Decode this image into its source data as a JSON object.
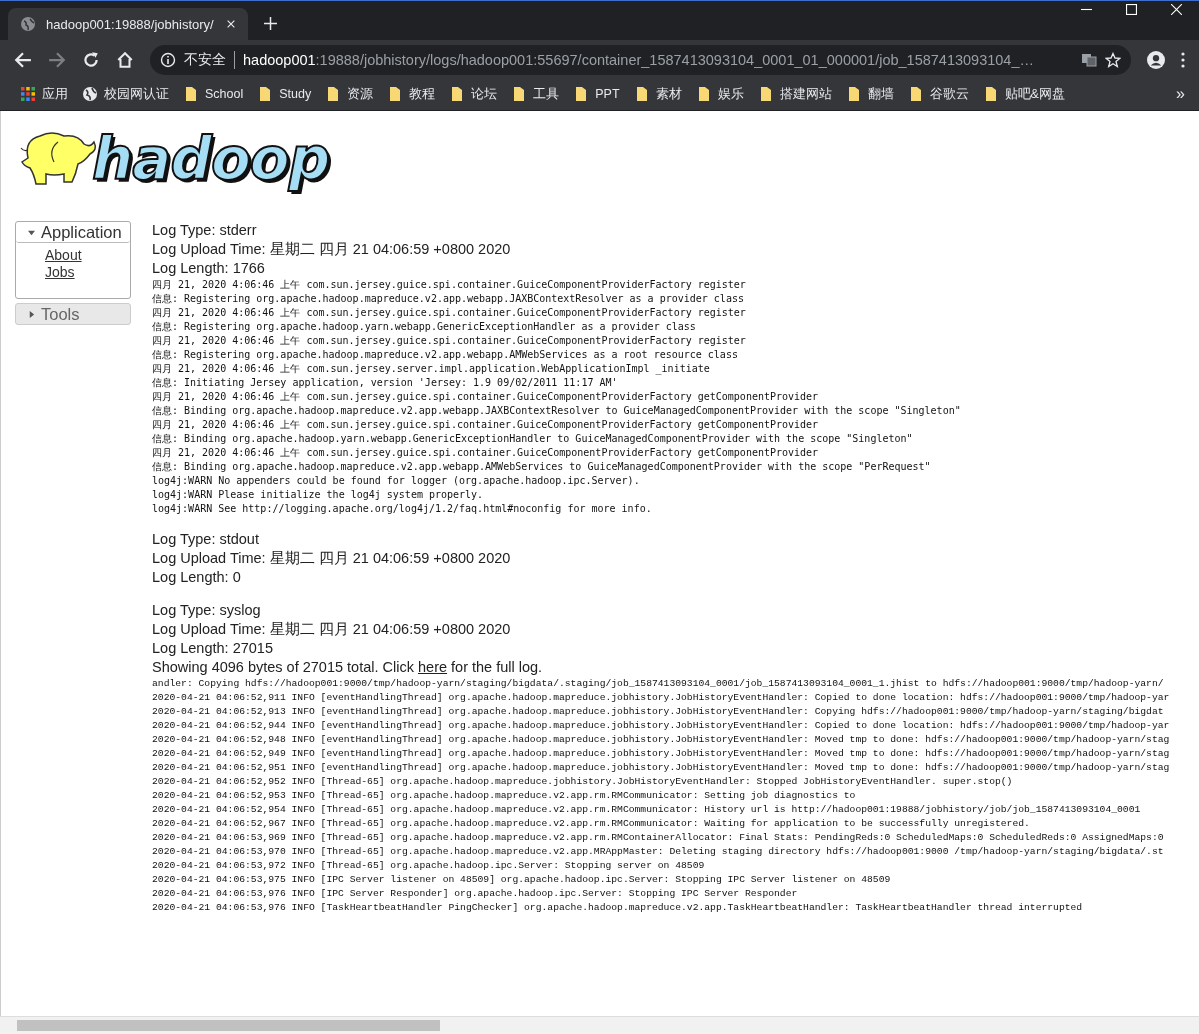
{
  "browser": {
    "tab_title": "hadoop001:19888/jobhistory/",
    "address": {
      "security": "不安全",
      "host": "hadoop001",
      "path": ":19888/jobhistory/logs/hadoop001:55697/container_1587413093104_0001_01_000001/job_1587413093104_…"
    },
    "bookmarks": [
      {
        "label": "应用",
        "kind": "apps"
      },
      {
        "label": "校园网认证",
        "kind": "globe"
      },
      {
        "label": "School",
        "kind": "folder"
      },
      {
        "label": "Study",
        "kind": "folder"
      },
      {
        "label": "资源",
        "kind": "folder"
      },
      {
        "label": "教程",
        "kind": "folder"
      },
      {
        "label": "论坛",
        "kind": "folder"
      },
      {
        "label": "工具",
        "kind": "folder"
      },
      {
        "label": "PPT",
        "kind": "folder"
      },
      {
        "label": "素材",
        "kind": "folder"
      },
      {
        "label": "娱乐",
        "kind": "folder"
      },
      {
        "label": "搭建网站",
        "kind": "folder"
      },
      {
        "label": "翻墙",
        "kind": "folder"
      },
      {
        "label": "谷歌云",
        "kind": "folder"
      },
      {
        "label": "贴吧&网盘",
        "kind": "folder"
      }
    ],
    "more": "»"
  },
  "logo": {
    "text": "hadoop"
  },
  "sidebar": [
    {
      "label": "Application",
      "expanded": true,
      "links": [
        "About",
        "Jobs"
      ]
    },
    {
      "label": "Tools",
      "expanded": false
    }
  ],
  "logs": [
    {
      "type": "Log Type: stderr",
      "upload": "Log Upload Time: 星期二 四月 21 04:06:59 +0800 2020",
      "length": "Log Length: 1766",
      "lines": [
        "四月 21, 2020 4:06:46 上午 com.sun.jersey.guice.spi.container.GuiceComponentProviderFactory register",
        "信息: Registering org.apache.hadoop.mapreduce.v2.app.webapp.JAXBContextResolver as a provider class",
        "四月 21, 2020 4:06:46 上午 com.sun.jersey.guice.spi.container.GuiceComponentProviderFactory register",
        "信息: Registering org.apache.hadoop.yarn.webapp.GenericExceptionHandler as a provider class",
        "四月 21, 2020 4:06:46 上午 com.sun.jersey.guice.spi.container.GuiceComponentProviderFactory register",
        "信息: Registering org.apache.hadoop.mapreduce.v2.app.webapp.AMWebServices as a root resource class",
        "四月 21, 2020 4:06:46 上午 com.sun.jersey.server.impl.application.WebApplicationImpl _initiate",
        "信息: Initiating Jersey application, version 'Jersey: 1.9 09/02/2011 11:17 AM'",
        "四月 21, 2020 4:06:46 上午 com.sun.jersey.guice.spi.container.GuiceComponentProviderFactory getComponentProvider",
        "信息: Binding org.apache.hadoop.mapreduce.v2.app.webapp.JAXBContextResolver to GuiceManagedComponentProvider with the scope \"Singleton\"",
        "四月 21, 2020 4:06:46 上午 com.sun.jersey.guice.spi.container.GuiceComponentProviderFactory getComponentProvider",
        "信息: Binding org.apache.hadoop.yarn.webapp.GenericExceptionHandler to GuiceManagedComponentProvider with the scope \"Singleton\"",
        "四月 21, 2020 4:06:46 上午 com.sun.jersey.guice.spi.container.GuiceComponentProviderFactory getComponentProvider",
        "信息: Binding org.apache.hadoop.mapreduce.v2.app.webapp.AMWebServices to GuiceManagedComponentProvider with the scope \"PerRequest\"",
        "log4j:WARN No appenders could be found for logger (org.apache.hadoop.ipc.Server).",
        "log4j:WARN Please initialize the log4j system properly.",
        "log4j:WARN See http://logging.apache.org/log4j/1.2/faq.html#noconfig for more info."
      ]
    },
    {
      "type": "Log Type: stdout",
      "upload": "Log Upload Time: 星期二 四月 21 04:06:59 +0800 2020",
      "length": "Log Length: 0"
    },
    {
      "type": "Log Type: syslog",
      "upload": "Log Upload Time: 星期二 四月 21 04:06:59 +0800 2020",
      "length": "Log Length: 27015",
      "note": {
        "before": "Showing 4096 bytes of 27015 total. Click",
        "link": "here",
        "after": "for the full log."
      },
      "lines": [
        "andler: Copying hdfs://hadoop001:9000/tmp/hadoop-yarn/staging/bigdata/.staging/job_1587413093104_0001/job_1587413093104_0001_1.jhist to hdfs://hadoop001:9000/tmp/hadoop-yarn/",
        "2020-04-21 04:06:52,911 INFO [eventHandlingThread] org.apache.hadoop.mapreduce.jobhistory.JobHistoryEventHandler: Copied to done location: hdfs://hadoop001:9000/tmp/hadoop-yar",
        "2020-04-21 04:06:52,913 INFO [eventHandlingThread] org.apache.hadoop.mapreduce.jobhistory.JobHistoryEventHandler: Copying hdfs://hadoop001:9000/tmp/hadoop-yarn/staging/bigdat",
        "2020-04-21 04:06:52,944 INFO [eventHandlingThread] org.apache.hadoop.mapreduce.jobhistory.JobHistoryEventHandler: Copied to done location: hdfs://hadoop001:9000/tmp/hadoop-yar",
        "2020-04-21 04:06:52,948 INFO [eventHandlingThread] org.apache.hadoop.mapreduce.jobhistory.JobHistoryEventHandler: Moved tmp to done: hdfs://hadoop001:9000/tmp/hadoop-yarn/stag",
        "2020-04-21 04:06:52,949 INFO [eventHandlingThread] org.apache.hadoop.mapreduce.jobhistory.JobHistoryEventHandler: Moved tmp to done: hdfs://hadoop001:9000/tmp/hadoop-yarn/stag",
        "2020-04-21 04:06:52,951 INFO [eventHandlingThread] org.apache.hadoop.mapreduce.jobhistory.JobHistoryEventHandler: Moved tmp to done: hdfs://hadoop001:9000/tmp/hadoop-yarn/stag",
        "2020-04-21 04:06:52,952 INFO [Thread-65] org.apache.hadoop.mapreduce.jobhistory.JobHistoryEventHandler: Stopped JobHistoryEventHandler. super.stop()",
        "2020-04-21 04:06:52,953 INFO [Thread-65] org.apache.hadoop.mapreduce.v2.app.rm.RMCommunicator: Setting job diagnostics to",
        "2020-04-21 04:06:52,954 INFO [Thread-65] org.apache.hadoop.mapreduce.v2.app.rm.RMCommunicator: History url is http://hadoop001:19888/jobhistory/job/job_1587413093104_0001",
        "2020-04-21 04:06:52,967 INFO [Thread-65] org.apache.hadoop.mapreduce.v2.app.rm.RMCommunicator: Waiting for application to be successfully unregistered.",
        "2020-04-21 04:06:53,969 INFO [Thread-65] org.apache.hadoop.mapreduce.v2.app.rm.RMContainerAllocator: Final Stats: PendingReds:0 ScheduledMaps:0 ScheduledReds:0 AssignedMaps:0",
        "2020-04-21 04:06:53,970 INFO [Thread-65] org.apache.hadoop.mapreduce.v2.app.MRAppMaster: Deleting staging directory hdfs://hadoop001:9000 /tmp/hadoop-yarn/staging/bigdata/.st",
        "2020-04-21 04:06:53,972 INFO [Thread-65] org.apache.hadoop.ipc.Server: Stopping server on 48509",
        "2020-04-21 04:06:53,975 INFO [IPC Server listener on 48509] org.apache.hadoop.ipc.Server: Stopping IPC Server listener on 48509",
        "2020-04-21 04:06:53,976 INFO [IPC Server Responder] org.apache.hadoop.ipc.Server: Stopping IPC Server Responder",
        "2020-04-21 04:06:53,976 INFO [TaskHeartbeatHandler PingChecker] org.apache.hadoop.mapreduce.v2.app.TaskHeartbeatHandler: TaskHeartbeatHandler thread interrupted"
      ]
    }
  ]
}
